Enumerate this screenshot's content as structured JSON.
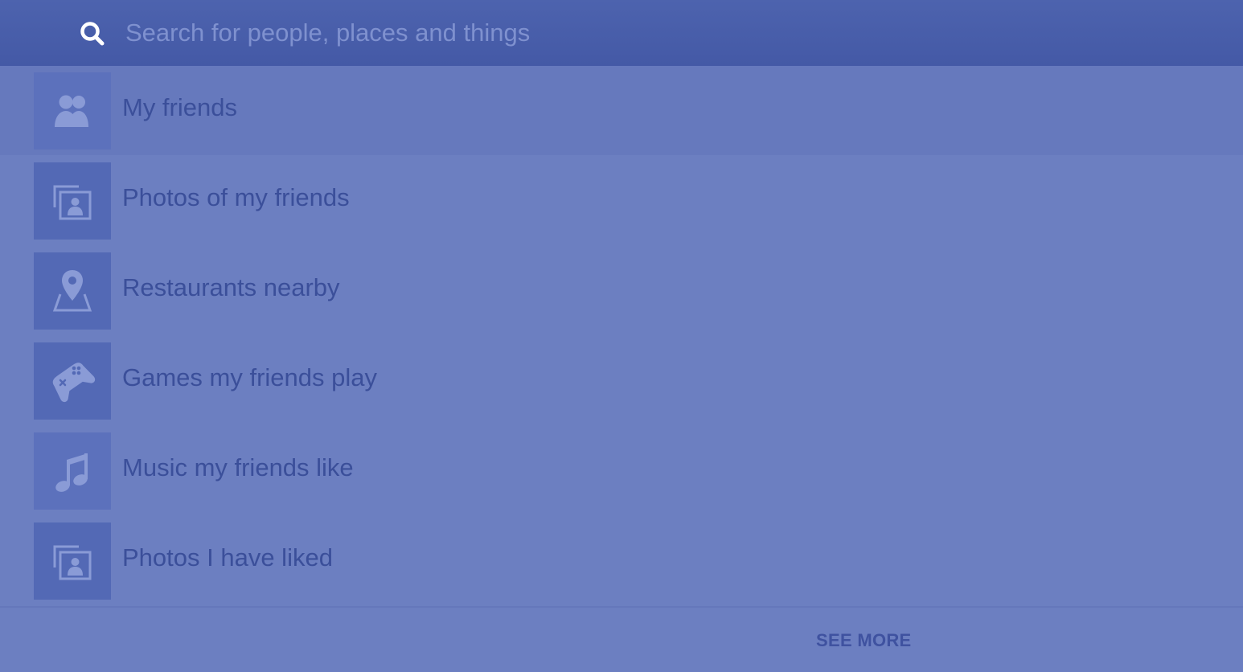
{
  "search": {
    "placeholder": "Search for people, places and things",
    "value": ""
  },
  "suggestions": [
    {
      "label": "My friends",
      "icon": "friends-icon",
      "selected": true
    },
    {
      "label": "Photos of my friends",
      "icon": "photos-icon",
      "selected": false
    },
    {
      "label": "Restaurants nearby",
      "icon": "map-pin-icon",
      "selected": false
    },
    {
      "label": "Games my friends play",
      "icon": "gamepad-icon",
      "selected": false
    },
    {
      "label": "Music my friends like",
      "icon": "music-note-icon",
      "selected": false
    },
    {
      "label": "Photos I have liked",
      "icon": "photos-icon",
      "selected": false
    }
  ],
  "footer": {
    "see_more_label": "SEE MORE"
  },
  "colors": {
    "header": "#4a5fab",
    "background": "#6c7fc1",
    "tile": "#5369b5",
    "label_text": "#3b4f9a"
  }
}
